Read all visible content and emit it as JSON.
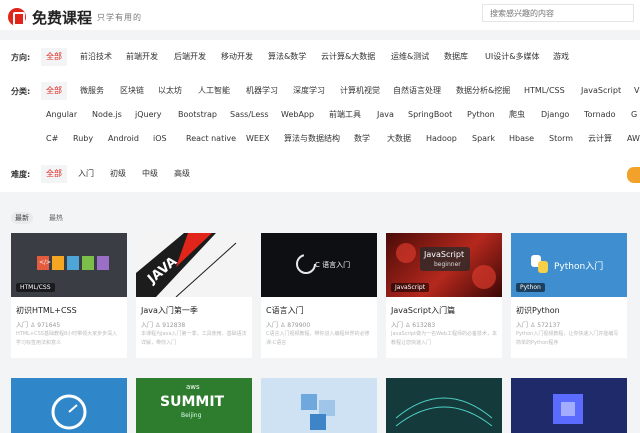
{
  "header": {
    "title": "免费课程",
    "slogan": "只学有用的",
    "search_placeholder": "搜索感兴趣的内容"
  },
  "filters": {
    "direction": {
      "label": "方向:",
      "items": [
        "全部",
        "前沿技术",
        "前端开发",
        "后端开发",
        "移动开发",
        "算法&数学",
        "云计算&大数据",
        "运维&测试",
        "数据库",
        "UI设计&多媒体",
        "游戏"
      ]
    },
    "category": {
      "label": "分类:",
      "line1": [
        "全部",
        "微服务",
        "区块链",
        "以太坊",
        "人工智能",
        "机器学习",
        "深度学习",
        "计算机视觉",
        "自然语言处理",
        "数据分析&挖掘",
        "HTML/CSS",
        "JavaScript",
        "V"
      ],
      "line2": [
        "Angular",
        "Node.js",
        "jQuery",
        "Bootstrap",
        "Sass/Less",
        "WebApp",
        "前端工具",
        "Java",
        "SpringBoot",
        "Python",
        "爬虫",
        "Django",
        "Tornado",
        "G"
      ],
      "line3": [
        "C#",
        "Ruby",
        "Android",
        "iOS",
        "React native",
        "WEEX",
        "算法与数据结构",
        "数学",
        "大数据",
        "Hadoop",
        "Spark",
        "Hbase",
        "Storm",
        "云计算",
        "AW"
      ]
    },
    "difficulty": {
      "label": "难度:",
      "items": [
        "全部",
        "入门",
        "初级",
        "中级",
        "高级"
      ]
    }
  },
  "sort_tabs": [
    "最新",
    "最热"
  ],
  "courses": [
    {
      "title": "初识HTML+CSS",
      "level": "入门",
      "count": "971645",
      "badge": "HTML/CSS",
      "thumb_text": "</>",
      "desc": "HTML+CSS基础教程8小时带领大家步步深入学习标签用法和意义"
    },
    {
      "title": "Java入门第一季",
      "level": "入门",
      "count": "912838",
      "badge": "",
      "thumb_text": "JAVA",
      "desc": "本课程为Java入门第一季，工具使用、基础语法详解，带你入门"
    },
    {
      "title": "C语言入门",
      "level": "入门",
      "count": "879900",
      "badge": "",
      "thumb_text": "C 语言入门",
      "desc": "C语言入门视频教程，带你进入编程世界的必修课-C语言"
    },
    {
      "title": "JavaScript入门篇",
      "level": "入门",
      "count": "613283",
      "badge": "JavaScript",
      "thumb_text": "JavaScript",
      "thumb_sub": "beginner",
      "desc": "JavaScript做为一名Web工程师的必备技术，本教程让您快速入门"
    },
    {
      "title": "初识Python",
      "level": "入门",
      "count": "572137",
      "badge": "Python",
      "thumb_text": "Python入门",
      "desc": "Python入门视频教程，让你快速入门并能编写简单的Python程序"
    }
  ],
  "second_row": {
    "summit_top": "aws",
    "summit_text": "SUMMIT",
    "summit_sub": "Beijing"
  },
  "colors": {
    "accent": "#e1251b",
    "orange": "#f2a12a"
  }
}
